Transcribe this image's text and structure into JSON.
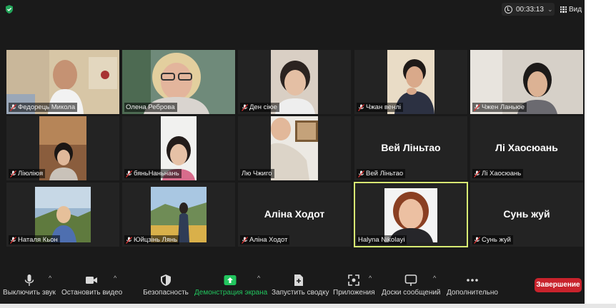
{
  "meeting": {
    "timer": "00:33:13",
    "view_label": "Вид"
  },
  "participants": [
    {
      "name": "Федорець Микола",
      "display": ""
    },
    {
      "name": "Олена Реброва",
      "display": ""
    },
    {
      "name": "Ден сіюе",
      "display": ""
    },
    {
      "name": "Чжан венлі",
      "display": ""
    },
    {
      "name": "Чжен Ланьюе",
      "display": ""
    },
    {
      "name": "Ліюліюя",
      "display": ""
    },
    {
      "name": "бяньНаньнань",
      "display": ""
    },
    {
      "name": "Лю Чжиго",
      "display": ""
    },
    {
      "name": "Вей Ліньтао",
      "display": "Вей Ліньтао"
    },
    {
      "name": "Лі Хаосюань",
      "display": "Лі Хаосюань"
    },
    {
      "name": "Наталя Кьон",
      "display": ""
    },
    {
      "name": "Юйцзінь Лянь",
      "display": ""
    },
    {
      "name": "Аліна Ходот",
      "display": "Аліна Ходот"
    },
    {
      "name": "Halyna Nikolayi",
      "display": ""
    },
    {
      "name": "Сунь жуй",
      "display": "Сунь жуй"
    }
  ],
  "toolbar": {
    "mute": "Выключить звук",
    "video": "Остановить видео",
    "security": "Безопасность",
    "share": "Демонстрация экрана",
    "poll": "Запустить сводку",
    "apps": "Приложения",
    "whiteboard": "Доски сообщений",
    "more": "Дополнительно",
    "end": "Завершение"
  },
  "colors": {
    "active_speaker": "#d8ec73",
    "share_green": "#22c55e",
    "end_red": "#c8232c"
  }
}
